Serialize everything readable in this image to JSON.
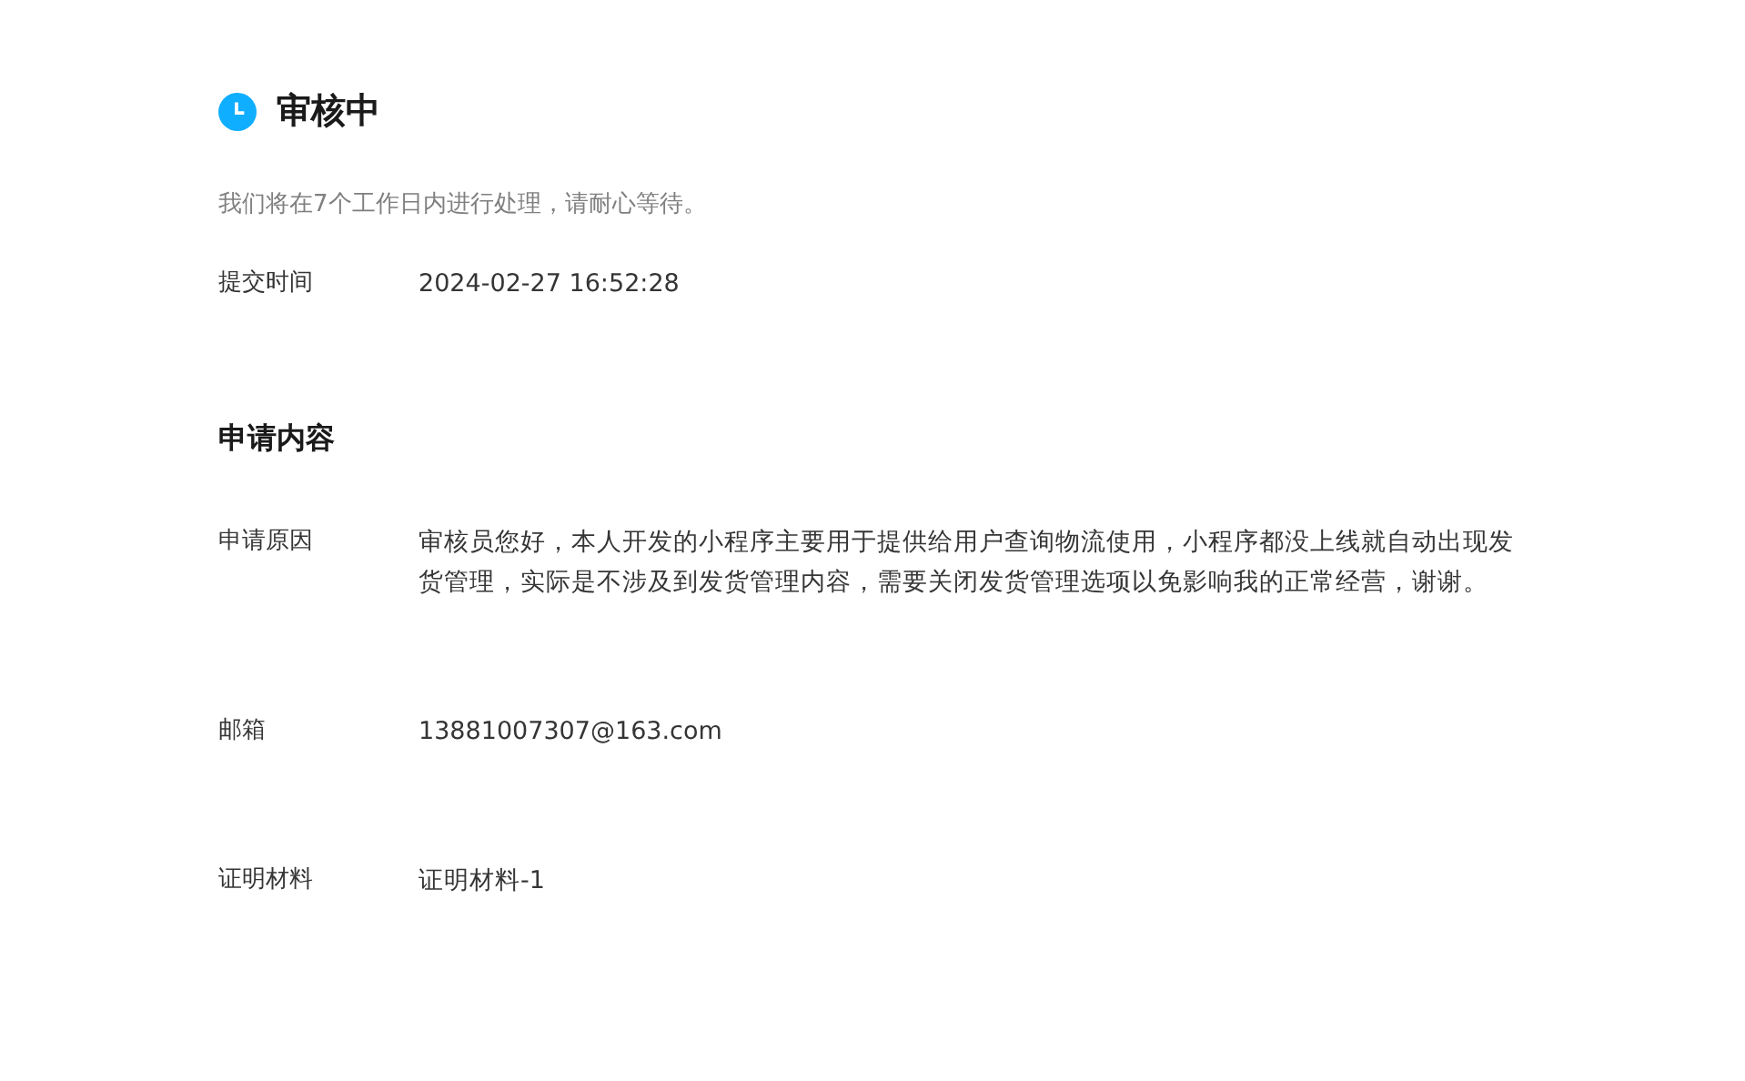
{
  "status": {
    "kind": "pending",
    "label": "审核中",
    "hint": "我们将在7个工作日内进行处理，请耐心等待。"
  },
  "submit": {
    "label": "提交时间",
    "value": "2024-02-27 16:52:28"
  },
  "section": {
    "title": "申请内容",
    "fields": [
      {
        "label": "申请原因",
        "value": "审核员您好，本人开发的小程序主要用于提供给用户查询物流使用，小程序都没上线就自动出现发货管理，实际是不涉及到发货管理内容，需要关闭发货管理选项以免影响我的正常经营，谢谢。"
      },
      {
        "label": "邮箱",
        "value": "13881007307@163.com"
      },
      {
        "label": "证明材料",
        "value": "证明材料-1"
      }
    ]
  }
}
